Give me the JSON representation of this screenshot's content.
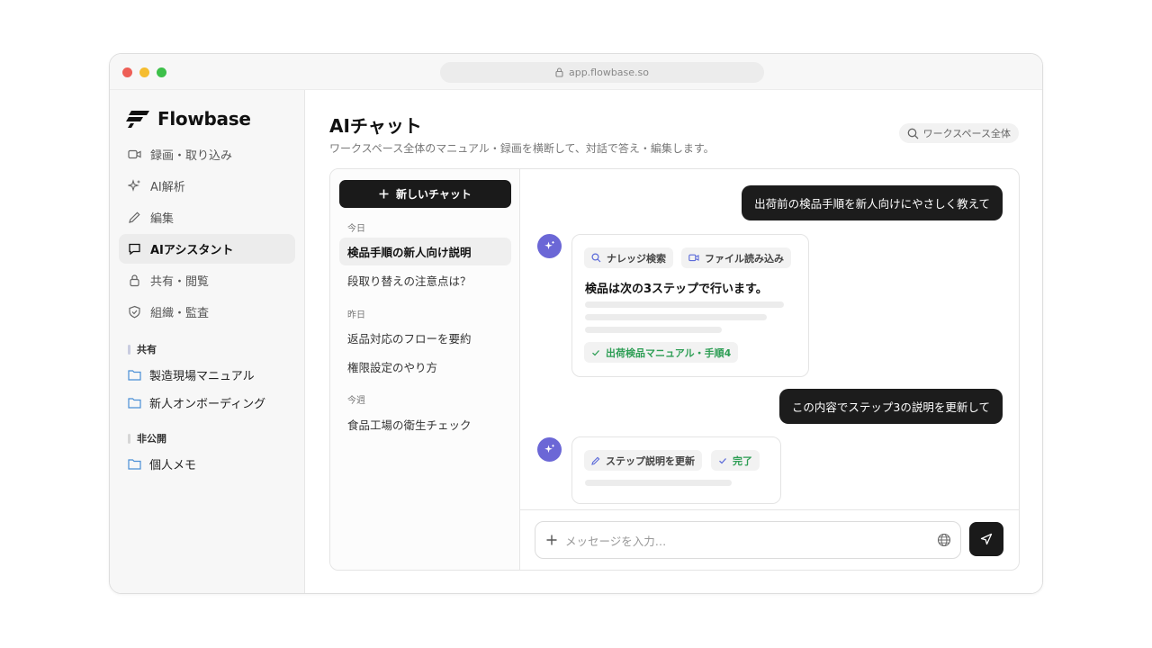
{
  "browser": {
    "url": "app.flowbase.so"
  },
  "brand": {
    "name": "Flowbase"
  },
  "sidebar": {
    "nav": [
      {
        "label": "録画・取り込み",
        "icon": "video-icon"
      },
      {
        "label": "AI解析",
        "icon": "sparkle-icon"
      },
      {
        "label": "編集",
        "icon": "pencil-icon"
      },
      {
        "label": "AIアシスタント",
        "icon": "chat-icon",
        "active": true
      },
      {
        "label": "共有・閲覧",
        "icon": "lock-icon"
      },
      {
        "label": "組織・監査",
        "icon": "shield-icon"
      }
    ],
    "shared_label": "共有",
    "shared_folders": [
      "製造現場マニュアル",
      "新人オンボーディング"
    ],
    "private_label": "非公開",
    "private_folders": [
      "個人メモ"
    ]
  },
  "header": {
    "title": "AIチャット",
    "subtitle": "ワークスペース全体のマニュアル・録画を横断して、対話で答え・編集します。",
    "scope": "ワークスペース全体"
  },
  "chat_list": {
    "new_chat": "新しいチャット",
    "groups": [
      {
        "label": "今日",
        "items": [
          "検品手順の新人向け説明",
          "段取り替えの注意点は？"
        ]
      },
      {
        "label": "昨日",
        "items": [
          "返品対応のフローを要約",
          "権限設定のやり方"
        ]
      },
      {
        "label": "今週",
        "items": [
          "食品工場の衛生チェック"
        ]
      }
    ]
  },
  "messages": {
    "user1": "出荷前の検品手順を新人向けにやさしく教えて",
    "ai1": {
      "tool1": "ナレッジ検索",
      "tool2": "ファイル読み込み",
      "title": "検品は次の3ステップで行います。",
      "source": "出荷検品マニュアル・手順4"
    },
    "user2": "この内容でステップ3の説明を更新して",
    "ai2": {
      "tool1": "ステップ説明を更新",
      "status": "完了"
    }
  },
  "composer": {
    "placeholder": "メッセージを入力…"
  },
  "colors": {
    "accent": "#6b67d6",
    "dark": "#1a1a1a",
    "success": "#2e9e55"
  }
}
